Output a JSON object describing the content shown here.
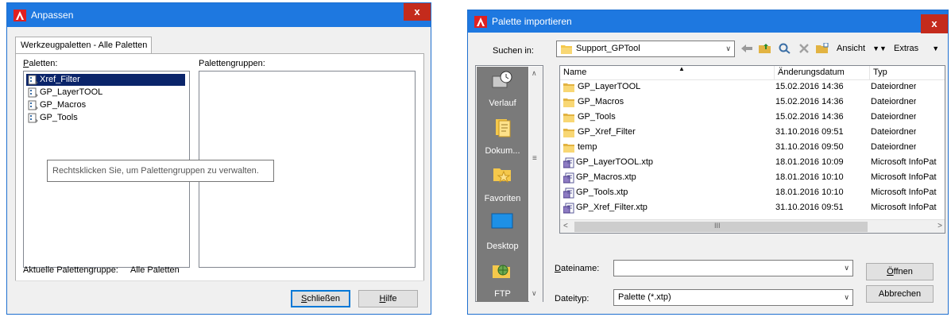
{
  "left_dialog": {
    "title": "Anpassen",
    "close_label": "x",
    "tab_label": "Werkzeugpaletten - Alle Paletten",
    "palettes_label": "Paletten:",
    "palette_groups_label": "Palettengruppen:",
    "palettes": [
      {
        "label": "Xref_Filter",
        "selected": true
      },
      {
        "label": "GP_LayerTOOL",
        "selected": false
      },
      {
        "label": "GP_Macros",
        "selected": false
      },
      {
        "label": "GP_Tools",
        "selected": false
      }
    ],
    "tooltip": "Rechtsklicken Sie, um Palettengruppen zu verwalten.",
    "current_group_label": "Aktuelle Palettengruppe:",
    "current_group_value": "Alle Paletten",
    "close_button": "Schließen",
    "help_button": "Hilfe"
  },
  "right_dialog": {
    "title": "Palette importieren",
    "close_label": "x",
    "look_in_label": "Suchen in:",
    "look_in_value": "Support_GPTool",
    "view_label": "Ansicht",
    "tools_label": "Extras",
    "places": [
      "Verlauf",
      "Dokum...",
      "Favoriten",
      "Desktop",
      "FTP"
    ],
    "columns": [
      "Name",
      "Änderungsdatum",
      "Typ"
    ],
    "files": [
      {
        "name": "GP_LayerTOOL",
        "date": "15.02.2016 14:36",
        "type": "Dateiordner",
        "kind": "folder"
      },
      {
        "name": "GP_Macros",
        "date": "15.02.2016 14:36",
        "type": "Dateiordner",
        "kind": "folder"
      },
      {
        "name": "GP_Tools",
        "date": "15.02.2016 14:36",
        "type": "Dateiordner",
        "kind": "folder"
      },
      {
        "name": "GP_Xref_Filter",
        "date": "31.10.2016 09:51",
        "type": "Dateiordner",
        "kind": "folder"
      },
      {
        "name": "temp",
        "date": "31.10.2016 09:50",
        "type": "Dateiordner",
        "kind": "folder"
      },
      {
        "name": "GP_LayerTOOL.xtp",
        "date": "18.01.2016 10:09",
        "type": "Microsoft InfoPat",
        "kind": "file"
      },
      {
        "name": "GP_Macros.xtp",
        "date": "18.01.2016 10:10",
        "type": "Microsoft InfoPat",
        "kind": "file"
      },
      {
        "name": "GP_Tools.xtp",
        "date": "18.01.2016 10:10",
        "type": "Microsoft InfoPat",
        "kind": "file"
      },
      {
        "name": "GP_Xref_Filter.xtp",
        "date": "31.10.2016 09:51",
        "type": "Microsoft InfoPat",
        "kind": "file"
      }
    ],
    "hscroll_grip": "III",
    "filename_label": "Dateiname:",
    "filename_value": "",
    "filetype_label": "Dateityp:",
    "filetype_value": "Palette (*.xtp)",
    "open_button": "Öffnen",
    "cancel_button": "Abbrechen"
  },
  "colors": {
    "titlebar": "#1e78e0",
    "close": "#c42b1c",
    "selection": "#0a246a",
    "places_bg": "#7a7a7a",
    "folder": "#f5c84b"
  }
}
